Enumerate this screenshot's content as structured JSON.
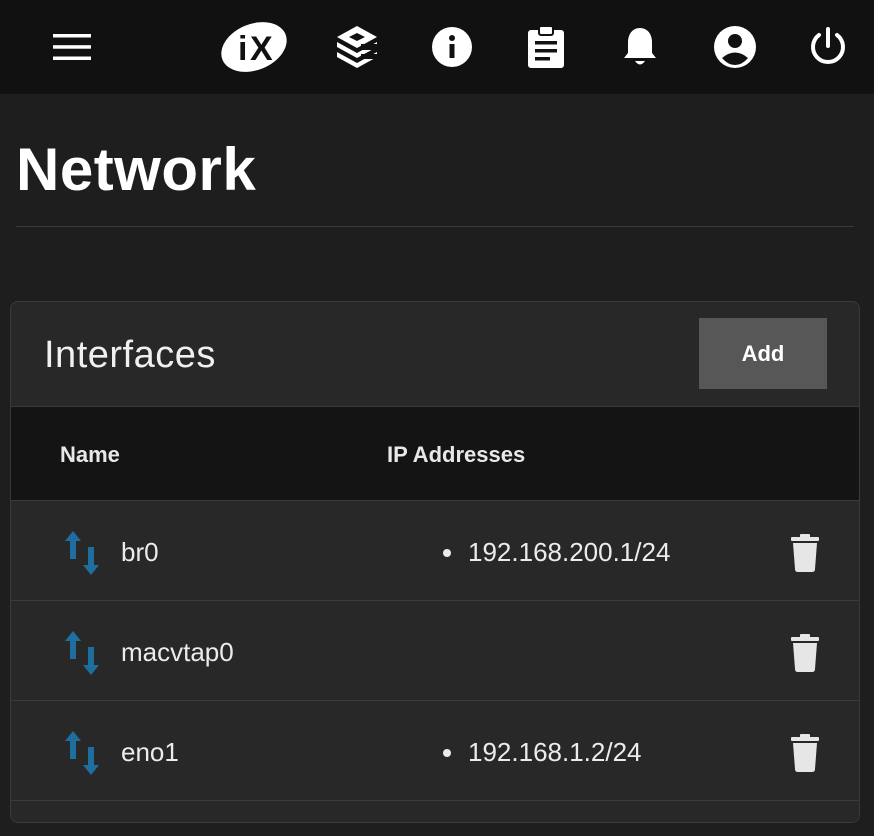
{
  "topbar": {
    "icons": [
      "menu-icon",
      "ix-logo-icon",
      "truecommand-icon",
      "info-icon",
      "tasks-clipboard-icon",
      "bell-icon",
      "account-icon",
      "power-icon"
    ]
  },
  "page": {
    "title": "Network"
  },
  "interfaces_card": {
    "title": "Interfaces",
    "add_label": "Add",
    "columns": {
      "name": "Name",
      "ip_addresses": "IP Addresses"
    },
    "rows": [
      {
        "name": "br0",
        "ip_addresses": [
          "192.168.200.1/24"
        ]
      },
      {
        "name": "macvtap0",
        "ip_addresses": []
      },
      {
        "name": "eno1",
        "ip_addresses": [
          "192.168.1.2/24"
        ]
      }
    ]
  },
  "colors": {
    "topbar_bg": "#111111",
    "page_bg": "#1e1e1e",
    "card_bg": "#282828",
    "table_head_bg": "#141414",
    "add_button_bg": "#575757",
    "interface_icon_color": "#1f6ea0"
  }
}
